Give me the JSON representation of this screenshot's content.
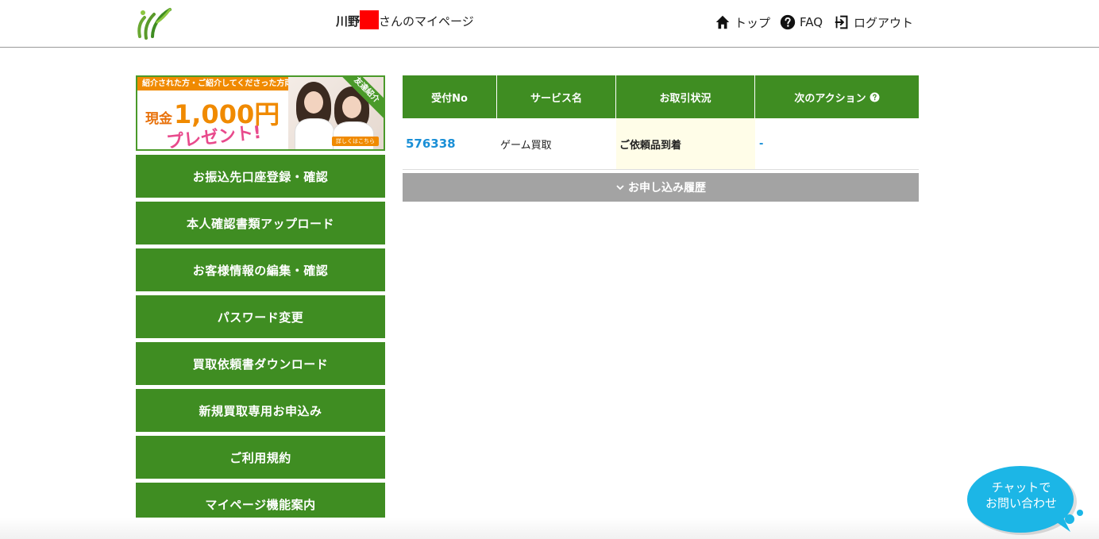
{
  "header": {
    "logo_icon": "sprout-logo-icon",
    "greeting_surname": "川野",
    "greeting_suffix": "さんのマイページ",
    "nav": [
      {
        "label": "トップ",
        "icon": "home-icon"
      },
      {
        "label": "FAQ",
        "icon": "help-circle-icon"
      },
      {
        "label": "ログアウト",
        "icon": "logout-icon"
      }
    ]
  },
  "banner": {
    "band_text": "紹介された方・ご紹介してくださった方両方に",
    "cash_prefix": "現金",
    "cash_amount": "1,000円",
    "present": "プレゼント!",
    "tag": "友達紹介",
    "detail": "詳しくはこちら"
  },
  "sidebar": {
    "items": [
      {
        "label": "お振込先口座登録・確認"
      },
      {
        "label": "本人確認書類アップロード"
      },
      {
        "label": "お客様情報の編集・確認"
      },
      {
        "label": "パスワード変更"
      },
      {
        "label": "買取依頼書ダウンロード"
      },
      {
        "label": "新規買取専用お申込み"
      },
      {
        "label": "ご利用規約"
      },
      {
        "label": "マイページ機能案内"
      }
    ]
  },
  "table": {
    "headers": [
      "受付No",
      "サービス名",
      "お取引状況",
      "次のアクション"
    ],
    "rows": [
      {
        "no": "576338",
        "service": "ゲーム買取",
        "status": "ご依頼品到着",
        "action": "-"
      }
    ]
  },
  "history_label": "お申し込み履歴",
  "chat": {
    "label": "チャットで\nお問い合わせ"
  },
  "colors": {
    "green": "#3f8d22",
    "link_blue": "#1a8fd6",
    "gray_bar": "#a3a3a3",
    "chat_blue": "#1cb6e6",
    "status_bg": "#fffde8",
    "redaction": "#ff0000"
  }
}
